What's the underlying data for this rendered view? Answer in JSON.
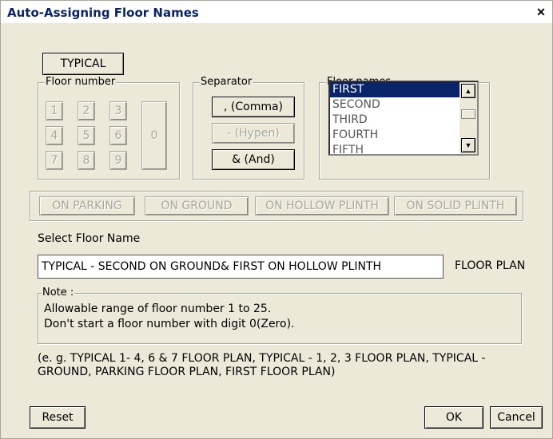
{
  "window": {
    "title": "Auto-Assigning Floor Names",
    "close_glyph": "✕"
  },
  "typical_button": "TYPICAL",
  "floor_number": {
    "label": "Floor number",
    "keys": [
      "1",
      "2",
      "3",
      "4",
      "5",
      "6",
      "7",
      "8",
      "9"
    ],
    "zero_key": "0"
  },
  "separator": {
    "label": "Separator",
    "comma": ", (Comma)",
    "hyphen": "- (Hypen)",
    "and": "& (And)"
  },
  "floor_names": {
    "label": "Floor names",
    "items": [
      "FIRST",
      "SECOND",
      "THIRD",
      "FOURTH",
      "FIFTH"
    ],
    "selected": "FIRST"
  },
  "on_buttons": [
    "ON PARKING",
    "ON GROUND",
    "ON HOLLOW PLINTH",
    "ON SOLID PLINTH"
  ],
  "select_floor_name": {
    "label": "Select Floor Name",
    "value": "TYPICAL - SECOND ON GROUND& FIRST ON HOLLOW PLINTH",
    "suffix": "FLOOR PLAN"
  },
  "note": {
    "label": "Note :",
    "line1": "Allowable range of floor number 1 to 25.",
    "line2": "Don't start a floor number with digit 0(Zero)."
  },
  "example": {
    "line1": "(e. g. TYPICAL 1- 4, 6 & 7 FLOOR PLAN, TYPICAL - 1, 2, 3  FLOOR PLAN, TYPICAL -",
    "line2": "GROUND, PARKING FLOOR PLAN, FIRST FLOOR PLAN)"
  },
  "footer": {
    "reset": "Reset",
    "ok": "OK",
    "cancel": "Cancel"
  },
  "colors": {
    "dialog_bg": "#ece9d8",
    "selection": "#0a246a",
    "title_text": "#0a246a",
    "disabled_text": "#a7a69a"
  }
}
